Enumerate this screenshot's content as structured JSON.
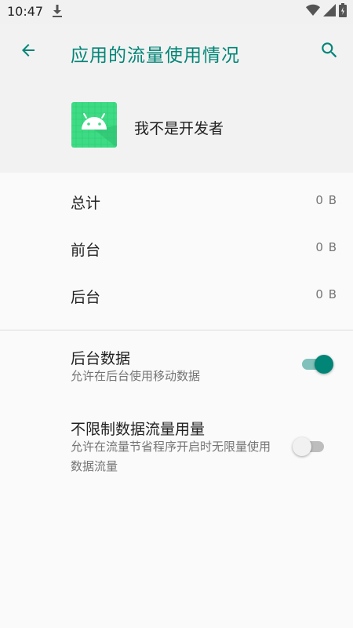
{
  "status_bar": {
    "time": "10:47",
    "icons": [
      "download-icon",
      "wifi-icon",
      "signal-icon",
      "battery-icon"
    ]
  },
  "toolbar": {
    "title": "应用的流量使用情况",
    "back_icon": "arrow-back-icon",
    "search_icon": "search-icon",
    "accent_color": "#008577"
  },
  "app": {
    "name": "我不是开发者",
    "icon": "android-robot-icon",
    "icon_color": "#3ddc84"
  },
  "usage": [
    {
      "label": "总计",
      "value": "0 B"
    },
    {
      "label": "前台",
      "value": "0 B"
    },
    {
      "label": "后台",
      "value": "0 B"
    }
  ],
  "preferences": [
    {
      "title": "后台数据",
      "summary": "允许在后台使用移动数据",
      "enabled": true
    },
    {
      "title": "不限制数据流量用量",
      "summary": "允许在流量节省程序开启时无限量使用数据流量",
      "enabled": false
    }
  ]
}
